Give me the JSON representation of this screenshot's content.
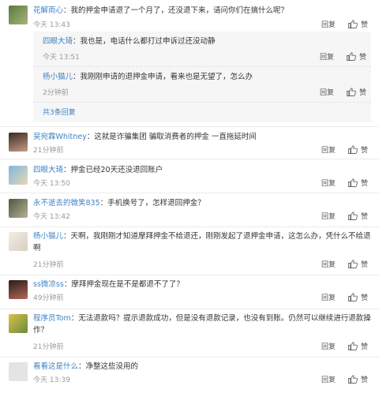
{
  "comments": [
    {
      "user": "花解雨心",
      "text": "：我的押金申请退了一个月了，还没退下来，请问你们在搞什么呢？",
      "time": "今天 13:43",
      "reply": "回复",
      "like": "赞"
    },
    {
      "user": "吴宛霖Whitney",
      "text": "：这就是诈骗集团 骗取消费者的押金 一直拖延时间",
      "time": "21分钟前",
      "reply": "回复",
      "like": "赞"
    },
    {
      "user": "四眼大琦",
      "text": "：押金已经20天还没退回账户",
      "time": "今天 13:50",
      "reply": "回复",
      "like": "赞"
    },
    {
      "user": "永不逝去的微笑835",
      "text": "：手机换号了，怎样退回押金？",
      "time": "今天 13:42",
      "reply": "回复",
      "like": "赞"
    },
    {
      "user": "杨小猫儿",
      "text": "：天啊，我刚刚才知道摩拜押金不给退还，刚刚发起了退押金申请，这怎么办，凭什么不给退啊",
      "time": "21分钟前",
      "reply": "回复",
      "like": "赞"
    },
    {
      "user": "ss微凉ss",
      "text": "：摩拜押金现在是不是都退不了了？",
      "time": "49分钟前",
      "reply": "回复",
      "like": "赞"
    },
    {
      "user": "程序员Tom",
      "text": "：无法退款吗？提示退款成功，但是没有退款记录，也没有到账。仍然可以继续进行退款操作？",
      "time": "21分钟前",
      "reply": "回复",
      "like": "赞"
    },
    {
      "user": "看看这是什么",
      "text": "：净整这些没用的",
      "time": "今天 13:39",
      "reply": "回复",
      "like": "赞"
    }
  ],
  "replies": [
    {
      "user": "四眼大琦",
      "text": "：我也是，电话什么都打过申诉过还没动静",
      "time": "今天 13:51",
      "reply": "回复",
      "like": "赞"
    },
    {
      "user": "杨小猫儿",
      "text": "：我刚刚申请的退押金申请，看来也是无望了，怎么办",
      "time": "2分钟前",
      "reply": "回复",
      "like": "赞"
    }
  ],
  "more_replies": "共3条回复",
  "colors": {
    "username": "#3f82c4",
    "muted": "#9a9a9a"
  },
  "icons": {
    "like": "thumbs-up-icon"
  }
}
